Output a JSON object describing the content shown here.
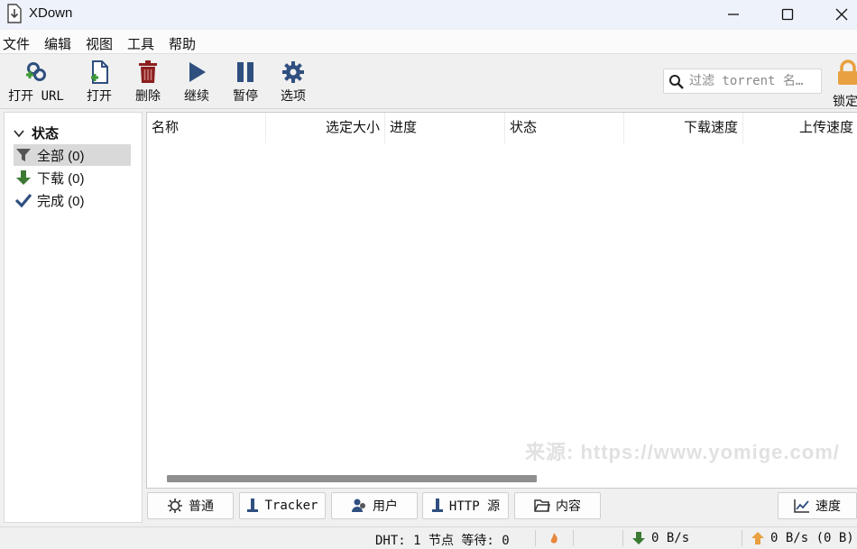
{
  "window": {
    "title": "XDown"
  },
  "menu": [
    "文件",
    "编辑",
    "视图",
    "工具",
    "帮助"
  ],
  "toolbar": {
    "open_url": "打开 URL",
    "open": "打开",
    "delete": "删除",
    "resume": "继续",
    "pause": "暂停",
    "options": "选项",
    "lock": "锁定"
  },
  "search": {
    "placeholder": "过滤 torrent 名…"
  },
  "sidebar": {
    "header": "状态",
    "items": [
      {
        "label": "全部 (0)",
        "icon": "filter-icon"
      },
      {
        "label": "下载 (0)",
        "icon": "down-arrow-icon"
      },
      {
        "label": "完成 (0)",
        "icon": "check-icon"
      }
    ]
  },
  "table": {
    "columns": [
      "名称",
      "选定大小",
      "进度",
      "状态",
      "下载速度",
      "上传速度"
    ]
  },
  "tabs": {
    "general": "普通",
    "tracker": "Tracker",
    "peers": "用户",
    "http": "HTTP 源",
    "content": "内容",
    "speed": "速度"
  },
  "status": {
    "dht": "DHT: 1 节点 等待: 0",
    "down": "0 B/s",
    "up": "0 B/s (0 B)"
  },
  "watermark": "来源: https://www.yomige.com/",
  "colors": {
    "green": "#3c7a34",
    "blue": "#2f4f7f",
    "red": "#8b1f1f",
    "orange": "#e8a040"
  }
}
